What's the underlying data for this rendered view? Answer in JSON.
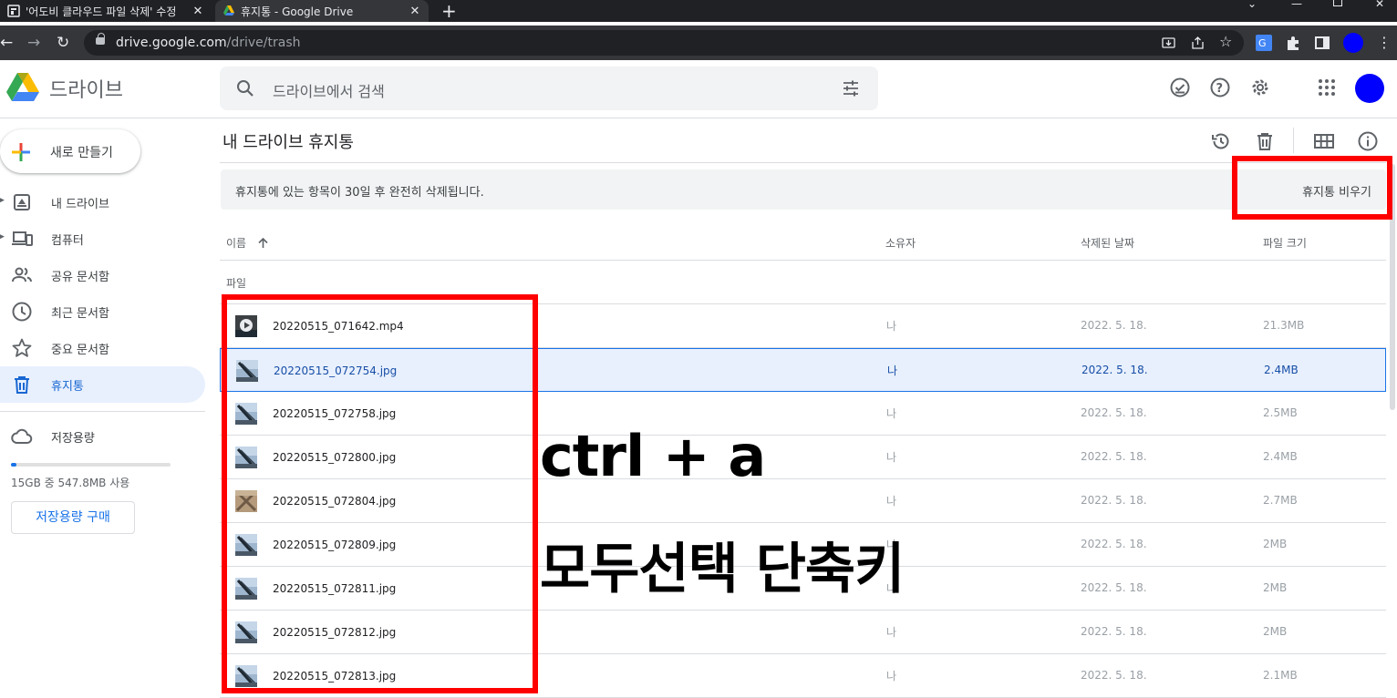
{
  "browser": {
    "tabs": [
      {
        "title": "'어도비 클라우드 파일 삭제' 수정",
        "active": false
      },
      {
        "title": "휴지통 - Google Drive",
        "active": true
      }
    ],
    "new_tab": "+",
    "url_host": "drive.google.com",
    "url_path": "/drive/trash"
  },
  "header": {
    "brand": "드라이브",
    "search_placeholder": "드라이브에서 검색"
  },
  "sidebar": {
    "new_label": "새로 만들기",
    "items": [
      {
        "label": "내 드라이브",
        "icon": "my-drive-icon"
      },
      {
        "label": "컴퓨터",
        "icon": "computer-icon"
      },
      {
        "label": "공유 문서함",
        "icon": "shared-icon"
      },
      {
        "label": "최근 문서함",
        "icon": "clock-icon"
      },
      {
        "label": "중요 문서함",
        "icon": "star-icon"
      },
      {
        "label": "휴지통",
        "icon": "trash-icon",
        "selected": true
      }
    ],
    "storage_label": "저장용량",
    "storage_used": "15GB 중 547.8MB 사용",
    "storage_fraction": 0.036,
    "buy_label": "저장용량 구매"
  },
  "main": {
    "title": "내 드라이브 휴지통",
    "banner_text": "휴지통에 있는 항목이 30일 후 완전히 삭제됩니다.",
    "empty_trash": "휴지통 비우기",
    "columns": {
      "name": "이름",
      "owner": "소유자",
      "deleted": "삭제된 날짜",
      "size": "파일 크기"
    },
    "section": "파일",
    "files": [
      {
        "name": "20220515_071642.mp4",
        "owner": "나",
        "date": "2022. 5. 18.",
        "size": "21.3MB",
        "type": "video"
      },
      {
        "name": "20220515_072754.jpg",
        "owner": "나",
        "date": "2022. 5. 18.",
        "size": "2.4MB",
        "type": "image",
        "selected": true
      },
      {
        "name": "20220515_072758.jpg",
        "owner": "나",
        "date": "2022. 5. 18.",
        "size": "2.5MB",
        "type": "image"
      },
      {
        "name": "20220515_072800.jpg",
        "owner": "나",
        "date": "2022. 5. 18.",
        "size": "2.4MB",
        "type": "image"
      },
      {
        "name": "20220515_072804.jpg",
        "owner": "나",
        "date": "2022. 5. 18.",
        "size": "2.7MB",
        "type": "image2"
      },
      {
        "name": "20220515_072809.jpg",
        "owner": "나",
        "date": "2022. 5. 18.",
        "size": "2MB",
        "type": "image"
      },
      {
        "name": "20220515_072811.jpg",
        "owner": "나",
        "date": "2022. 5. 18.",
        "size": "2MB",
        "type": "image"
      },
      {
        "name": "20220515_072812.jpg",
        "owner": "나",
        "date": "2022. 5. 18.",
        "size": "2MB",
        "type": "image"
      },
      {
        "name": "20220515_072813.jpg",
        "owner": "나",
        "date": "2022. 5. 18.",
        "size": "2.1MB",
        "type": "image"
      }
    ]
  },
  "annotation": {
    "line1": "ctrl + a",
    "line2": "모두선택 단축키",
    "highlight_color": "#ff0000"
  }
}
